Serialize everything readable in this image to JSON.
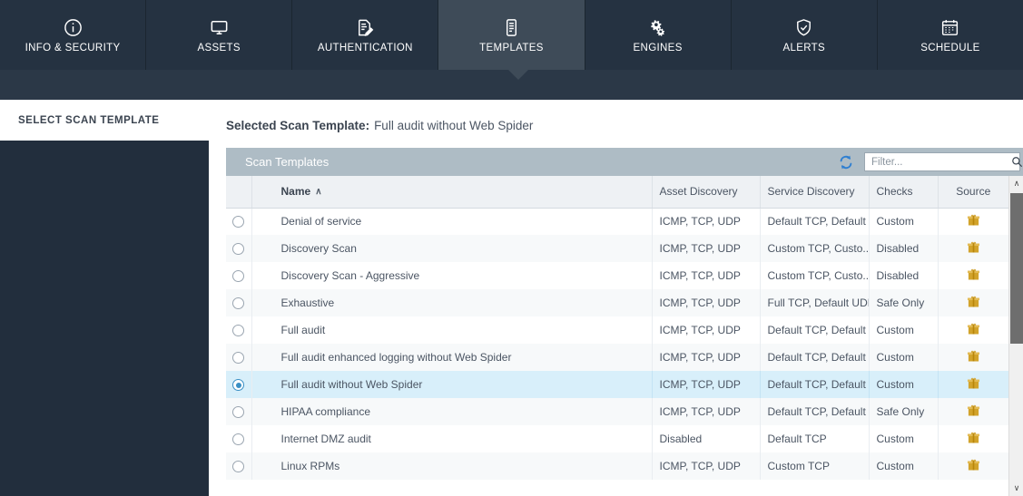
{
  "topnav": {
    "items": [
      {
        "label": "INFO & SECURITY",
        "icon": "info-circle-icon",
        "active": false
      },
      {
        "label": "ASSETS",
        "icon": "monitor-icon",
        "active": false
      },
      {
        "label": "AUTHENTICATION",
        "icon": "document-pencil-icon",
        "active": false
      },
      {
        "label": "TEMPLATES",
        "icon": "clipboard-icon",
        "active": true
      },
      {
        "label": "ENGINES",
        "icon": "gears-icon",
        "active": false
      },
      {
        "label": "ALERTS",
        "icon": "shield-icon",
        "active": false
      },
      {
        "label": "SCHEDULE",
        "icon": "calendar-icon",
        "active": false
      }
    ]
  },
  "sidebar": {
    "heading": "SELECT SCAN TEMPLATE"
  },
  "main": {
    "selected_label": "Selected Scan Template:",
    "selected_value": "Full audit without Web Spider",
    "panel_title": "Scan Templates",
    "refresh_icon": "refresh-icon",
    "search_icon": "search-icon",
    "filter_placeholder": "Filter...",
    "filter_value": ""
  },
  "table": {
    "columns": [
      "Name",
      "Asset Discovery",
      "Service Discovery",
      "Checks",
      "Source"
    ],
    "sort_column": "Name",
    "sort_direction": "asc",
    "sort_caret": "∧",
    "rows": [
      {
        "name": "Denial of service",
        "asset": "ICMP, TCP, UDP",
        "service": "Default TCP, Default ...",
        "checks": "Custom",
        "source": "package-icon",
        "selected": false
      },
      {
        "name": "Discovery Scan",
        "asset": "ICMP, TCP, UDP",
        "service": "Custom TCP, Custo...",
        "checks": "Disabled",
        "source": "package-icon",
        "selected": false
      },
      {
        "name": "Discovery Scan - Aggressive",
        "asset": "ICMP, TCP, UDP",
        "service": "Custom TCP, Custo...",
        "checks": "Disabled",
        "source": "package-icon",
        "selected": false
      },
      {
        "name": "Exhaustive",
        "asset": "ICMP, TCP, UDP",
        "service": "Full TCP, Default UDP",
        "checks": "Safe Only",
        "source": "package-icon",
        "selected": false
      },
      {
        "name": "Full audit",
        "asset": "ICMP, TCP, UDP",
        "service": "Default TCP, Default ...",
        "checks": "Custom",
        "source": "package-icon",
        "selected": false
      },
      {
        "name": "Full audit enhanced logging without Web Spider",
        "asset": "ICMP, TCP, UDP",
        "service": "Default TCP, Default ...",
        "checks": "Custom",
        "source": "package-icon",
        "selected": false
      },
      {
        "name": "Full audit without Web Spider",
        "asset": "ICMP, TCP, UDP",
        "service": "Default TCP, Default ...",
        "checks": "Custom",
        "source": "package-icon",
        "selected": true
      },
      {
        "name": "HIPAA compliance",
        "asset": "ICMP, TCP, UDP",
        "service": "Default TCP, Default ...",
        "checks": "Safe Only",
        "source": "package-icon",
        "selected": false
      },
      {
        "name": "Internet DMZ audit",
        "asset": "Disabled",
        "service": "Default TCP",
        "checks": "Custom",
        "source": "package-icon",
        "selected": false
      },
      {
        "name": "Linux RPMs",
        "asset": "ICMP, TCP, UDP",
        "service": "Custom TCP",
        "checks": "Custom",
        "source": "package-icon",
        "selected": false
      }
    ]
  },
  "scrollbar": {
    "up_arrow": "∧",
    "down_arrow": "∨"
  },
  "colors": {
    "nav_bg": "#253241",
    "nav_active_bg": "#3e4b58",
    "subbar_bg": "#2b3847",
    "sidebar_bg": "#222e3d",
    "panel_head_bg": "#aebcc5",
    "row_selected_bg": "#d8effa",
    "radio_accent": "#3a8fc4",
    "refresh_accent": "#2f7fd1",
    "package_gold": "#d2a32b"
  }
}
